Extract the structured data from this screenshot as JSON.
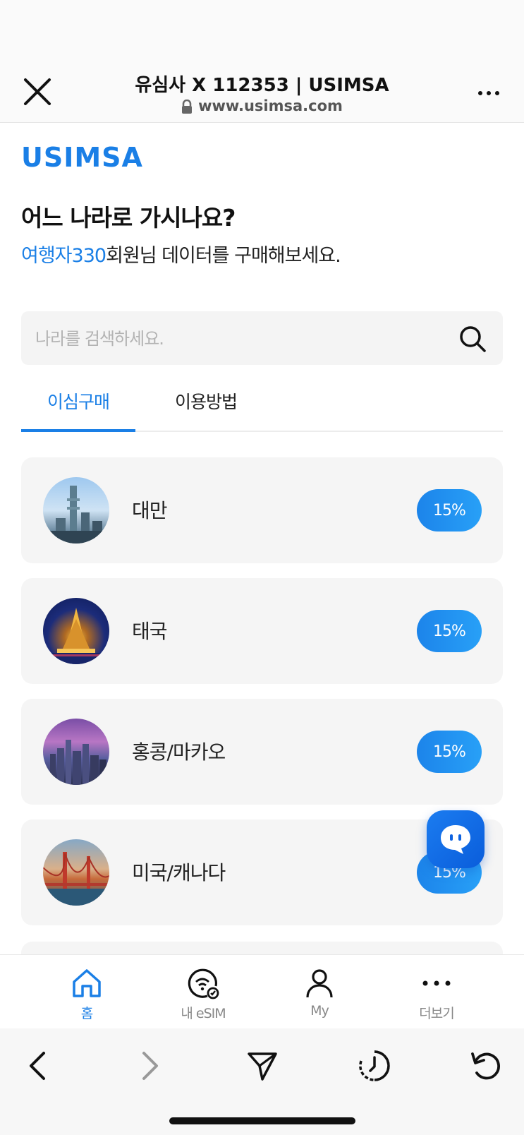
{
  "browser": {
    "title": "유심사 X 112353 | USIMSA",
    "url": "www.usimsa.com"
  },
  "brand": {
    "logo_text": "USIMSA",
    "color": "#1a7fe6"
  },
  "hero": {
    "headline": "어느 나라로 가시나요?",
    "member_name": "여행자330",
    "subline_rest": "회원님 데이터를 구매해보세요."
  },
  "search": {
    "placeholder": "나라를 검색하세요."
  },
  "tabs": [
    {
      "label": "이심구매",
      "active": true
    },
    {
      "label": "이용방법",
      "active": false
    }
  ],
  "countries": [
    {
      "name": "대만",
      "discount": "15%"
    },
    {
      "name": "태국",
      "discount": "15%"
    },
    {
      "name": "홍콩/마카오",
      "discount": "15%"
    },
    {
      "name": "미국/캐나다",
      "discount": "15%"
    }
  ],
  "bottom_nav": [
    {
      "label": "홈",
      "icon": "home-icon",
      "active": true
    },
    {
      "label": "내 eSIM",
      "icon": "esim-icon",
      "active": false
    },
    {
      "label": "My",
      "icon": "person-icon",
      "active": false
    },
    {
      "label": "더보기",
      "icon": "more-icon",
      "active": false
    }
  ]
}
